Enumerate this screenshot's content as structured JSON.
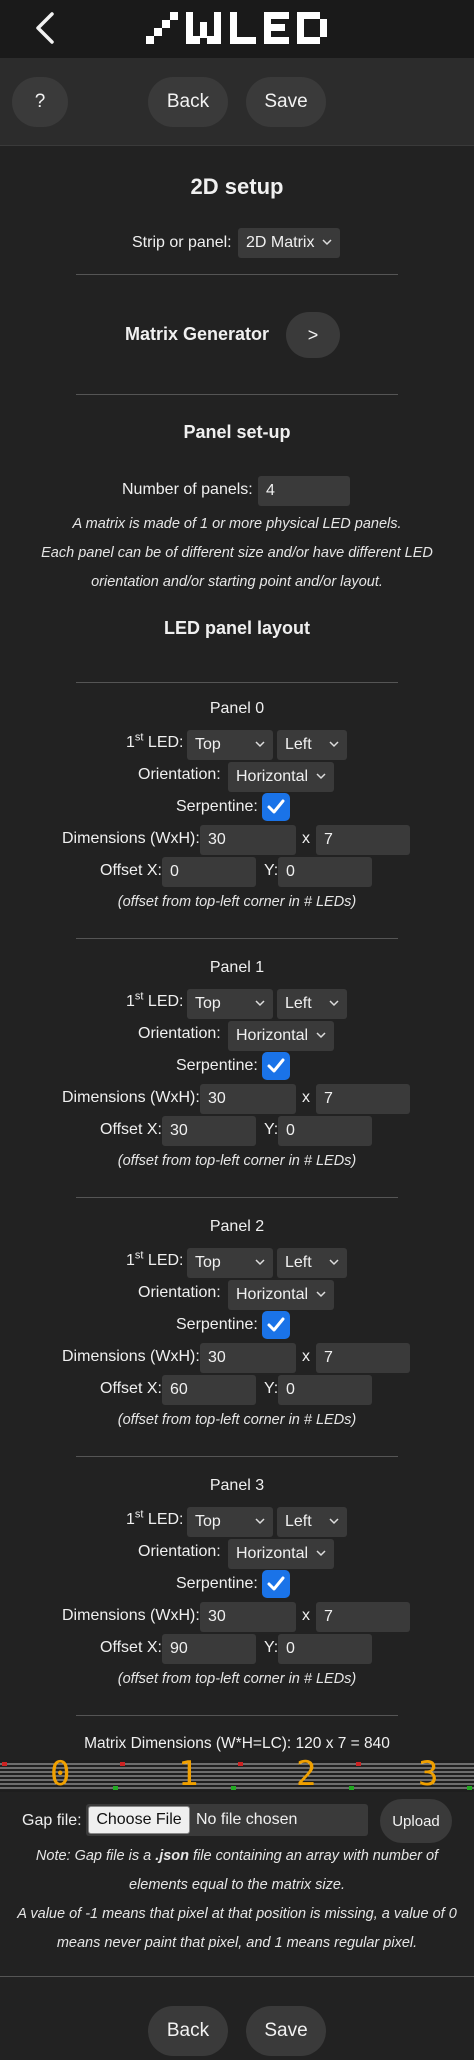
{
  "header": {
    "back_icon": "chevron-left-icon",
    "logo_text": "WLED"
  },
  "toolbar": {
    "help_label": "?",
    "back_label": "Back",
    "save_label": "Save"
  },
  "setup": {
    "title": "2D setup",
    "strip_label": "Strip or panel:",
    "strip_value": "2D Matrix",
    "generator_label": "Matrix Generator",
    "generator_button": ">",
    "panel_setup_title": "Panel set-up",
    "num_panels_label": "Number of panels:",
    "num_panels_value": "4",
    "note_line1": "A matrix is made of 1 or more physical LED panels.",
    "note_line2": "Each panel can be of different size and/or have different LED",
    "note_line3": "orientation and/or starting point and/or layout.",
    "layout_title": "LED panel layout"
  },
  "panel_labels": {
    "first_led_pre": "1",
    "first_led_sup": "st",
    "first_led_post": " LED:",
    "orientation": "Orientation:",
    "serpentine": "Serpentine:",
    "dimensions": "Dimensions (WxH):",
    "x_sep": "x",
    "offset_x": "Offset X:",
    "offset_y": "Y:",
    "offset_note": "(offset from top-left corner in # LEDs)"
  },
  "panels": [
    {
      "title": "Panel 0",
      "vstart": "Top",
      "hstart": "Left",
      "orientation": "Horizontal",
      "serpentine": true,
      "width": "30",
      "height": "7",
      "offset_x": "0",
      "offset_y": "0"
    },
    {
      "title": "Panel 1",
      "vstart": "Top",
      "hstart": "Left",
      "orientation": "Horizontal",
      "serpentine": true,
      "width": "30",
      "height": "7",
      "offset_x": "30",
      "offset_y": "0"
    },
    {
      "title": "Panel 2",
      "vstart": "Top",
      "hstart": "Left",
      "orientation": "Horizontal",
      "serpentine": true,
      "width": "30",
      "height": "7",
      "offset_x": "60",
      "offset_y": "0"
    },
    {
      "title": "Panel 3",
      "vstart": "Top",
      "hstart": "Left",
      "orientation": "Horizontal",
      "serpentine": true,
      "width": "30",
      "height": "7",
      "offset_x": "90",
      "offset_y": "0"
    }
  ],
  "matrix": {
    "dimensions_text": "Matrix Dimensions (W*H=LC): 120 x 7 = 840",
    "preview_numbers": [
      "0",
      "1",
      "2",
      "3"
    ],
    "preview_color": "#f0a000"
  },
  "gap": {
    "label": "Gap file:",
    "choose_label": "Choose File",
    "no_file": "No file chosen",
    "upload_label": "Upload",
    "note_line1_pre": "Note: Gap file is a ",
    "note_line1_bold": ".json",
    "note_line1_post": " file containing an array with number of",
    "note_line2": "elements equal to the matrix size.",
    "note_line3": "A value of -1 means that pixel at that position is missing, a value of 0",
    "note_line4": "means never paint that pixel, and 1 means regular pixel."
  },
  "footer": {
    "back_label": "Back",
    "save_label": "Save"
  },
  "colors": {
    "background": "#222222",
    "button": "#3a3a3a",
    "checkbox": "#1a73e8"
  }
}
